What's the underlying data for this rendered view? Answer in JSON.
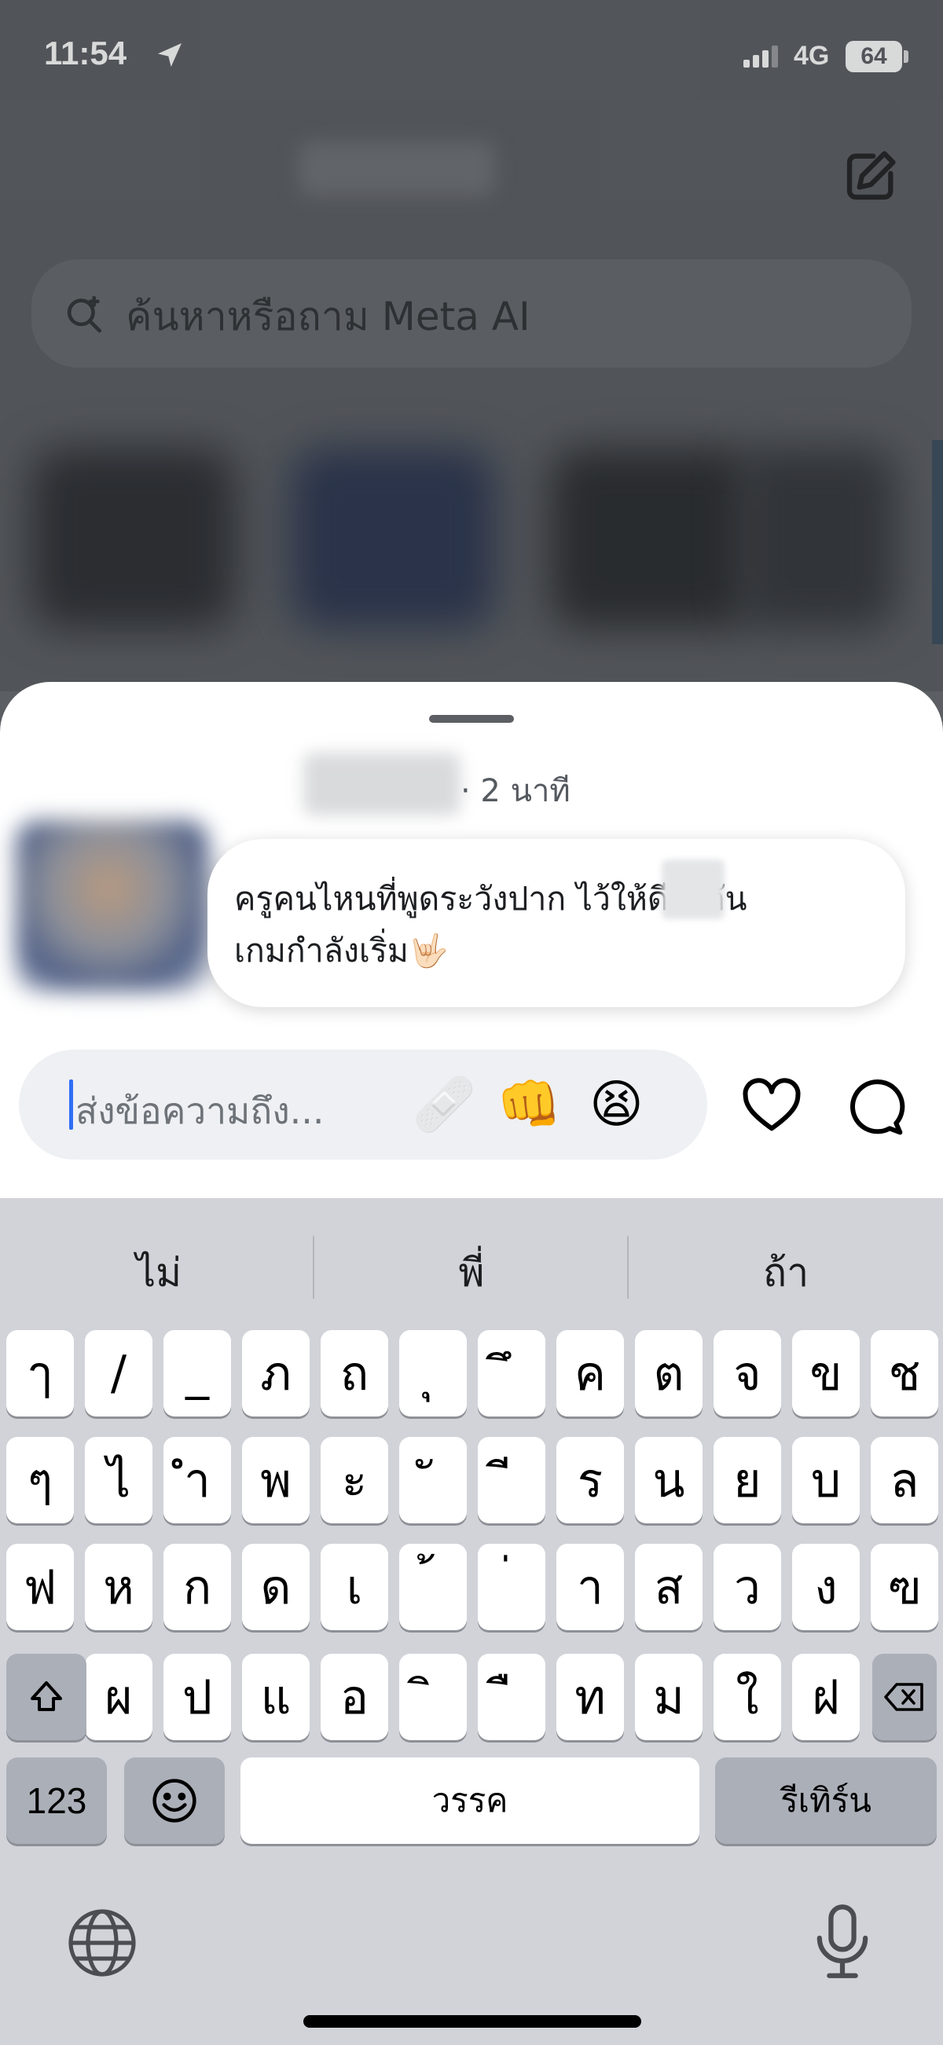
{
  "status_bar": {
    "time": "11:54",
    "network": "4G",
    "battery": "64"
  },
  "search": {
    "placeholder": "ค้นหาหรือถาม Meta AI"
  },
  "sheet": {
    "timestamp": "· 2 นาที",
    "message_line1": "ครูคนไหนที่พูดระวังปาก     ไว้ให้ดีละกัน",
    "message_line2": "เกมกำลังเริ่ม🤟🏻",
    "input_placeholder": "ส่งข้อความถึง...",
    "reactions": [
      "🩹",
      "👊",
      "😫"
    ]
  },
  "keyboard": {
    "suggestions": [
      "ไม่",
      "พี่",
      "ถ้า"
    ],
    "row1": [
      "ๅ",
      "/",
      "_",
      "ภ",
      "ถ",
      "ุ",
      "ึ",
      "ค",
      "ต",
      "จ",
      "ข",
      "ช"
    ],
    "row2": [
      "ๆ",
      "ไ",
      "ำ",
      "พ",
      "ะ",
      "ั",
      "ี",
      "ร",
      "น",
      "ย",
      "บ",
      "ล"
    ],
    "row3": [
      "ฟ",
      "ห",
      "ก",
      "ด",
      "เ",
      "้",
      "่",
      "า",
      "ส",
      "ว",
      "ง",
      "ฃ"
    ],
    "row4": [
      "ผ",
      "ป",
      "แ",
      "อ",
      "ิ",
      "ื",
      "ท",
      "ม",
      "ใ",
      "ฝ"
    ],
    "numbers_label": "123",
    "space_label": "วรรค",
    "return_label": "รีเทิร์น"
  },
  "colors": {
    "accent": "#2f6ef6",
    "sheet_bg": "#ffffff",
    "keyboard_bg": "#d1d3d9"
  }
}
